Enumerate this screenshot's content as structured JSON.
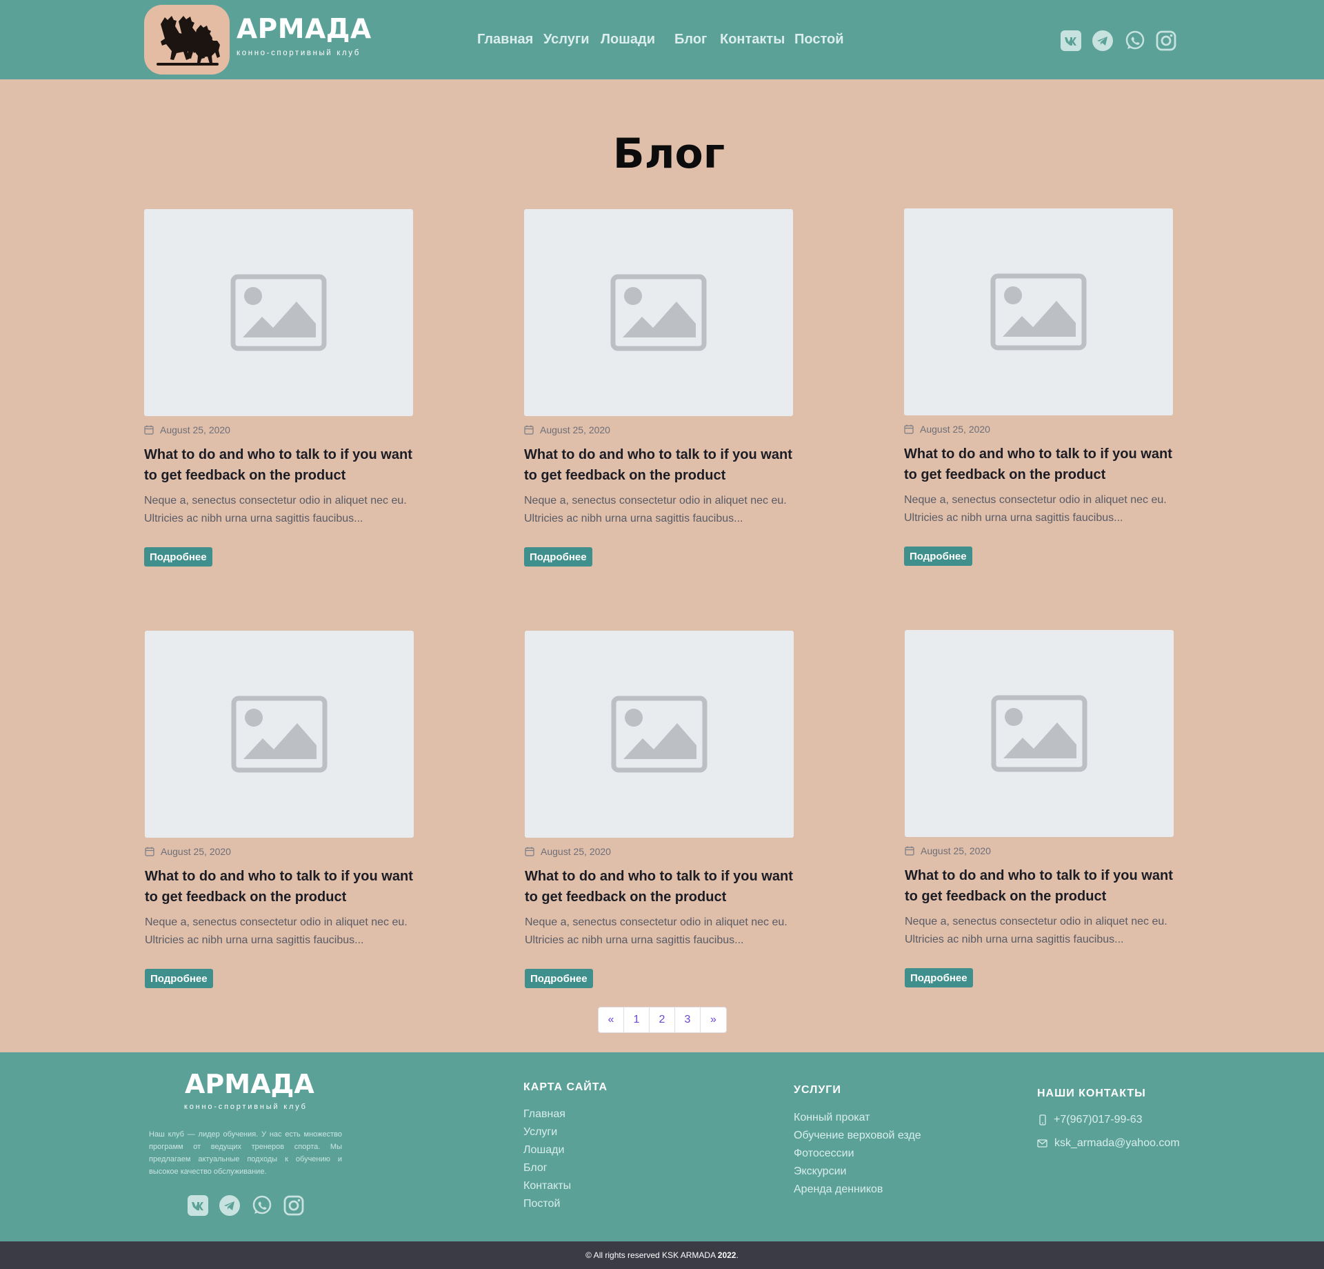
{
  "header": {
    "brand": "АРМАДА",
    "brand_sub": "конно-спортивный клуб",
    "nav": [
      "Главная",
      "Услуги",
      "Лошади",
      "Блог",
      "Контакты",
      "Постой"
    ],
    "social": [
      "vk-icon",
      "telegram-icon",
      "whatsapp-icon",
      "instagram-icon"
    ]
  },
  "page": {
    "title": "Блог"
  },
  "posts": [
    {
      "date": "August 25, 2020",
      "title": "What to do and who to talk to if you want to get feedback on the product",
      "excerpt": "Neque a, senectus consectetur odio in aliquet nec eu. Ultricies ac nibh urna urna sagittis faucibus...",
      "button": "Подробнее"
    },
    {
      "date": "August 25, 2020",
      "title": "What to do and who to talk to if you want to get feedback on the product",
      "excerpt": "Neque a, senectus consectetur odio in aliquet nec eu. Ultricies ac nibh urna urna sagittis faucibus...",
      "button": "Подробнее"
    },
    {
      "date": "August 25, 2020",
      "title": "What to do and who to talk to if you want to get feedback on the product",
      "excerpt": "Neque a, senectus consectetur odio in aliquet nec eu. Ultricies ac nibh urna urna sagittis faucibus...",
      "button": "Подробнее"
    },
    {
      "date": "August 25, 2020",
      "title": "What to do and who to talk to if you want to get feedback on the product",
      "excerpt": "Neque a, senectus consectetur odio in aliquet nec eu. Ultricies ac nibh urna urna sagittis faucibus...",
      "button": "Подробнее"
    },
    {
      "date": "August 25, 2020",
      "title": "What to do and who to talk to if you want to get feedback on the product",
      "excerpt": "Neque a, senectus consectetur odio in aliquet nec eu. Ultricies ac nibh urna urna sagittis faucibus...",
      "button": "Подробнее"
    },
    {
      "date": "August 25, 2020",
      "title": "What to do and who to talk to if you want to get feedback on the product",
      "excerpt": "Neque a, senectus consectetur odio in aliquet nec eu. Ultricies ac nibh urna urna sagittis faucibus...",
      "button": "Подробнее"
    }
  ],
  "pagination": {
    "prev": "«",
    "pages": [
      "1",
      "2",
      "3"
    ],
    "next": "»"
  },
  "footer": {
    "brand": "АРМАДА",
    "brand_sub": "конно-спортивный клуб",
    "about": "Наш клуб — лидер обучения. У нас есть множество программ от ведущих тренеров спорта. Мы предлагаем актуальные подходы к обучению и высокое качество обслуживание.",
    "sitemap_heading": "КАРТА САЙТА",
    "sitemap": [
      "Главная",
      "Услуги",
      "Лошади",
      "Блог",
      "Контакты",
      "Постой"
    ],
    "services_heading": "УСЛУГИ",
    "services": [
      "Конный прокат",
      "Обучение верховой езде",
      "Фотосессии",
      "Экскурсии",
      "Аренда денников"
    ],
    "contacts_heading": "НАШИ КОНТАКТЫ",
    "phone": "+7(967)017-99-63",
    "email": "ksk_armada@yahoo.com"
  },
  "copyright": {
    "text": "© All rights reserved KSK ARMADA",
    "year": "2022",
    "suffix": "."
  },
  "colors": {
    "header_bg": "#5ba198",
    "page_bg": "#dfbeaa",
    "button_bg": "#3f8f8c",
    "bottom_bar": "#3b3b45",
    "pager_link": "#6a45d6"
  }
}
